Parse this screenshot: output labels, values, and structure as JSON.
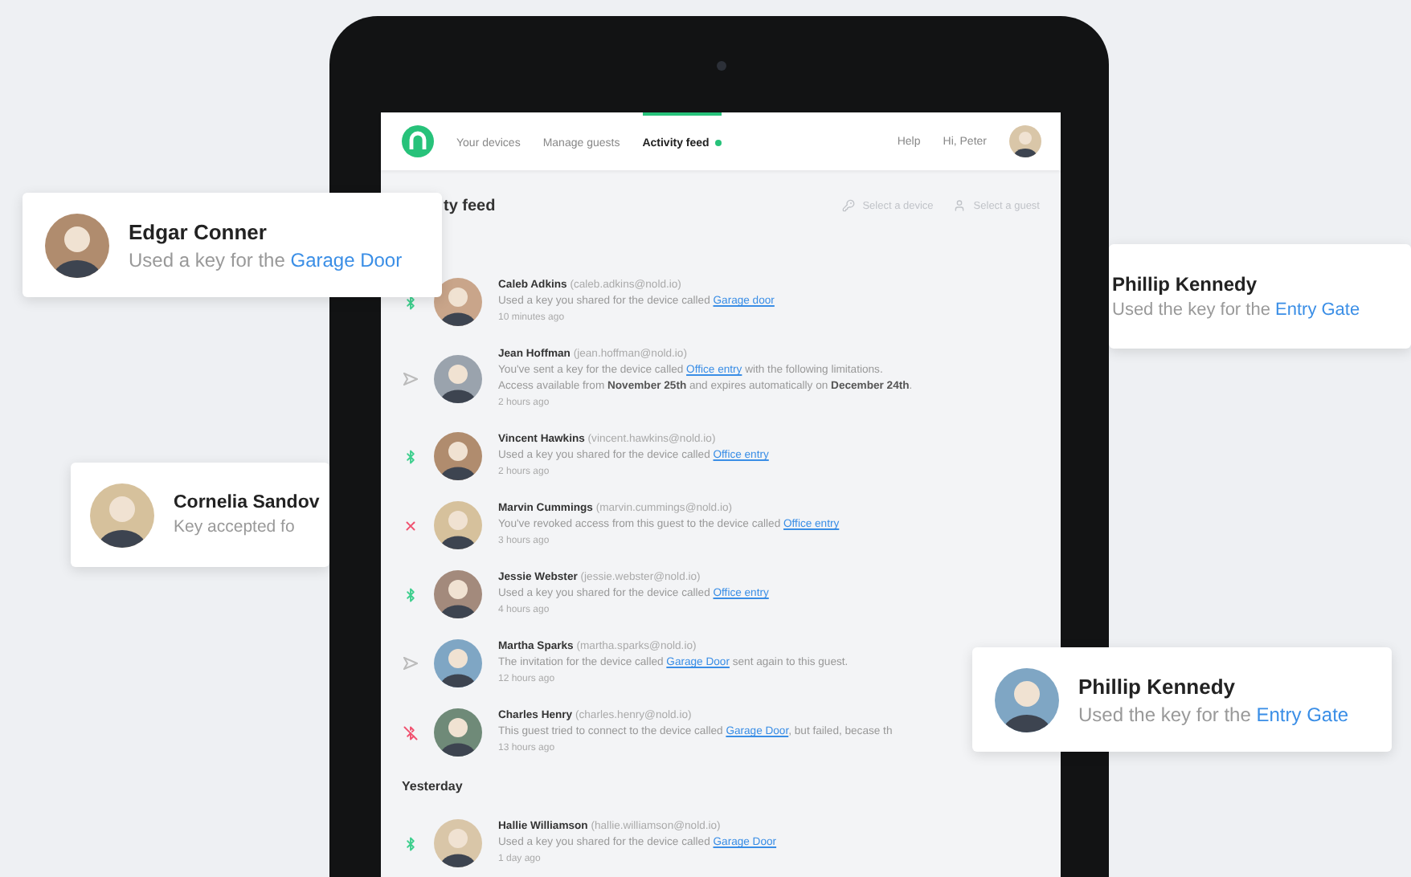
{
  "nav": {
    "tabs": [
      {
        "label": "Your devices",
        "selected": false,
        "dot": false
      },
      {
        "label": "Manage guests",
        "selected": false,
        "dot": false
      },
      {
        "label": "Activity feed",
        "selected": true,
        "dot": true
      }
    ],
    "help": "Help",
    "greeting": "Hi, Peter"
  },
  "page_title": "ty feed",
  "filters": [
    {
      "kind": "device",
      "label": "Select a device"
    },
    {
      "kind": "guest",
      "label": "Select a guest"
    }
  ],
  "groups": [
    {
      "items": [
        {
          "kind": "used",
          "name": "Caleb Adkins",
          "email": "(caleb.adkins@nold.io)",
          "before": "Used a key you shared for the device called",
          "link": "Garage door",
          "time": "10 minutes ago"
        },
        {
          "kind": "sent",
          "name": "Jean Hoffman",
          "email": "(jean.hoffman@nold.io)",
          "before": "You've sent a key for the device called",
          "link": "Office entry",
          "after": "with the following limitations.",
          "note": "Access available from **November 25th** and expires automatically on **December 24th**.",
          "time": "2 hours ago"
        },
        {
          "kind": "used",
          "name": "Vincent Hawkins",
          "email": "(vincent.hawkins@nold.io)",
          "before": "Used a key you shared for the device called",
          "link": "Office entry",
          "time": "2 hours ago"
        },
        {
          "kind": "revoked",
          "name": "Marvin Cummings",
          "email": "(marvin.cummings@nold.io)",
          "before": "You've revoked access from this guest to the device called",
          "link": "Office entry",
          "time": "3 hours ago"
        },
        {
          "kind": "used",
          "name": "Jessie Webster",
          "email": "(jessie.webster@nold.io)",
          "before": "Used a key you shared for the device called",
          "link": "Office entry",
          "time": "4 hours ago"
        },
        {
          "kind": "sent",
          "name": "Martha Sparks",
          "email": "(martha.sparks@nold.io)",
          "before": "The invitation for the device called",
          "link": "Garage Door",
          "after": "sent again to this guest.",
          "time": "12 hours ago"
        },
        {
          "kind": "failed",
          "name": "Charles Henry",
          "email": "(charles.henry@nold.io)",
          "before": "This guest tried to connect to the device called",
          "link": "Garage Door",
          "after": ", but failed, becase th",
          "time": "13 hours ago"
        }
      ]
    },
    {
      "label": "Yesterday",
      "items": [
        {
          "kind": "used",
          "name": "Hallie Williamson",
          "email": "(hallie.williamson@nold.io)",
          "before": "Used a key you shared for the device called",
          "link": "Garage Door",
          "time": "1 day ago"
        }
      ]
    }
  ],
  "cards": [
    {
      "avatar": true,
      "name": "Edgar Conner",
      "message": "Used a key for the",
      "link": "Garage Door"
    },
    {
      "avatar": true,
      "name": "Cornelia Sandov",
      "message": "Key accepted fo"
    },
    {
      "avatar": false,
      "name": "Phillip Kennedy",
      "message": "Used the key for the",
      "link": "Entry Gate"
    },
    {
      "avatar": true,
      "name": "Phillip Kennedy",
      "message": "Used the key for the",
      "link": "Entry Gate"
    }
  ]
}
